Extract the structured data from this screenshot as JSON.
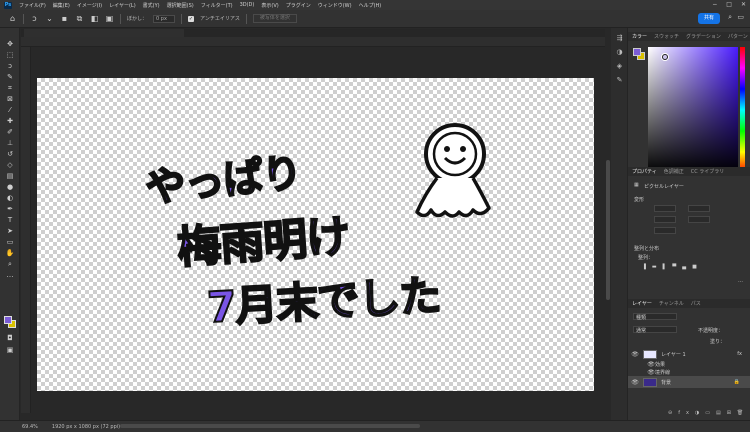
{
  "menubar": {
    "logo": "Ps",
    "items": [
      "ファイル(F)",
      "編集(E)",
      "イメージ(I)",
      "レイヤー(L)",
      "書式(Y)",
      "選択範囲(S)",
      "フィルター(T)",
      "3D(D)",
      "表示(V)",
      "プラグイン",
      "ウィンドウ(W)",
      "ヘルプ(H)"
    ]
  },
  "options": {
    "feather_label": "ぼかし：",
    "feather_value": "0 px",
    "antialias_label": "アンチエイリアス",
    "select_subject": "被写体を選択",
    "share": "共有"
  },
  "document_tab": "",
  "canvas_text": {
    "line1": "やっぱり",
    "line2": "梅雨明け",
    "line3": "7月末でした"
  },
  "status": {
    "zoom": "69.4%",
    "doc_info": "1920 px x 1080 px (72 ppi)"
  },
  "panels": {
    "color_tabs": [
      "カラー",
      "スウォッチ",
      "グラデーション",
      "パターン"
    ],
    "props_tabs": [
      "プロパティ",
      "色調補正",
      "CC ライブラリ"
    ],
    "pixel_layer": "ピクセルレイヤー",
    "transform": "変形",
    "align": "整列と分布",
    "align_sub": "整列：",
    "layers_tabs": [
      "レイヤー",
      "チャンネル",
      "パス"
    ],
    "kind_filter": "種類",
    "blend_mode": "通常",
    "opacity_label": "不透明度：",
    "fill_label": "塗り：",
    "layers": [
      {
        "name": "レイヤー 1",
        "fx": "fx"
      },
      {
        "name": "効果"
      },
      {
        "name": "境界線"
      },
      {
        "name": "背景"
      }
    ]
  },
  "colors": {
    "accent": "#7a55e6",
    "share": "#1473e6",
    "background_swatch": "#d8c000"
  }
}
